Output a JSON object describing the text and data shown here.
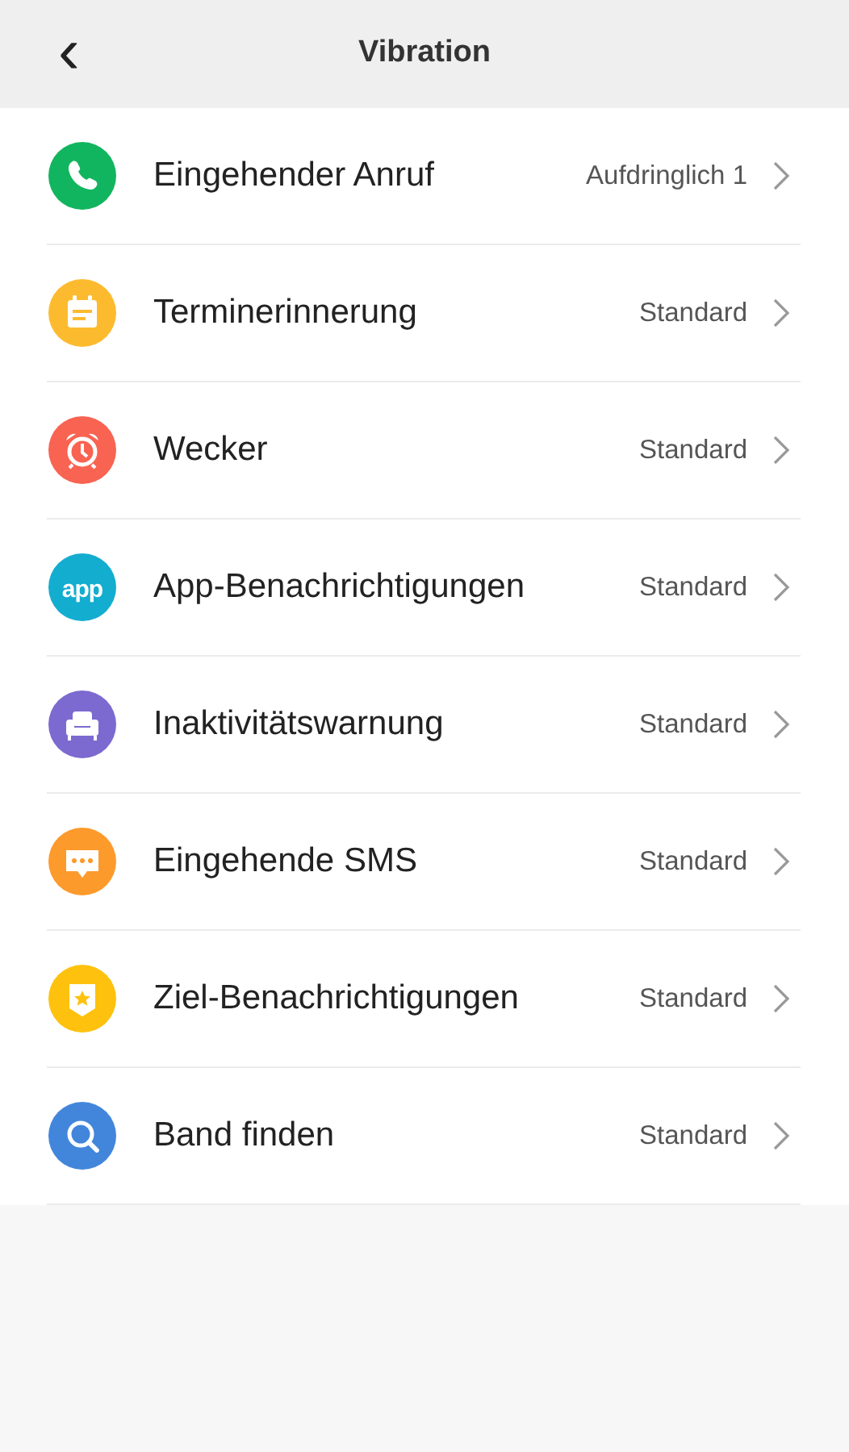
{
  "header": {
    "back": "‹",
    "title": "Vibration"
  },
  "items": [
    {
      "kind": "phone",
      "color": "#12b55f",
      "label": "Eingehender Anruf",
      "value": "Aufdringlich 1"
    },
    {
      "kind": "calendar",
      "color": "#fcbb2f",
      "label": "Terminerinnerung",
      "value": "Standard"
    },
    {
      "kind": "alarm",
      "color": "#f86352",
      "label": "Wecker",
      "value": "Standard"
    },
    {
      "kind": "app",
      "color": "#13add0",
      "icon_text": "app",
      "label": "App-Benachrichtigungen",
      "value": "Standard"
    },
    {
      "kind": "sofa",
      "color": "#7c6ad0",
      "label": "Inaktivitätswarnung",
      "value": "Standard"
    },
    {
      "kind": "message",
      "color": "#fd9a2c",
      "label": "Eingehende SMS",
      "value": "Standard"
    },
    {
      "kind": "badge",
      "color": "#fec20e",
      "label": "Ziel-Benachrichtigungen",
      "value": "Standard"
    },
    {
      "kind": "search",
      "color": "#4286dc",
      "label": "Band finden",
      "value": "Standard"
    }
  ]
}
